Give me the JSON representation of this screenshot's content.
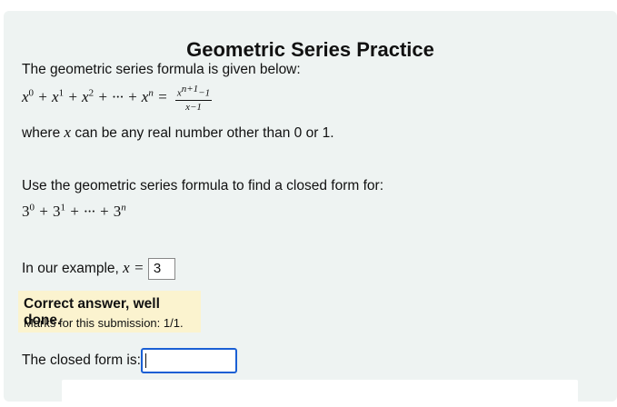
{
  "page": {
    "title": "Geometric Series Practice",
    "intro": "The geometric series formula is given below:",
    "where_text": "where",
    "where_var": "x",
    "where_rest": "can be any real number other than 0 or 1.",
    "question": "Use the geometric series formula to find a closed form for:",
    "example_prefix": "In our example,",
    "example_var": "x",
    "example_eq": "=",
    "example_answer": "3",
    "feedback": {
      "title": "Correct answer, well done.",
      "marks": "Marks for this submission: 1/1."
    },
    "closed_form_label": "The closed form is:",
    "closed_form_value": ""
  }
}
